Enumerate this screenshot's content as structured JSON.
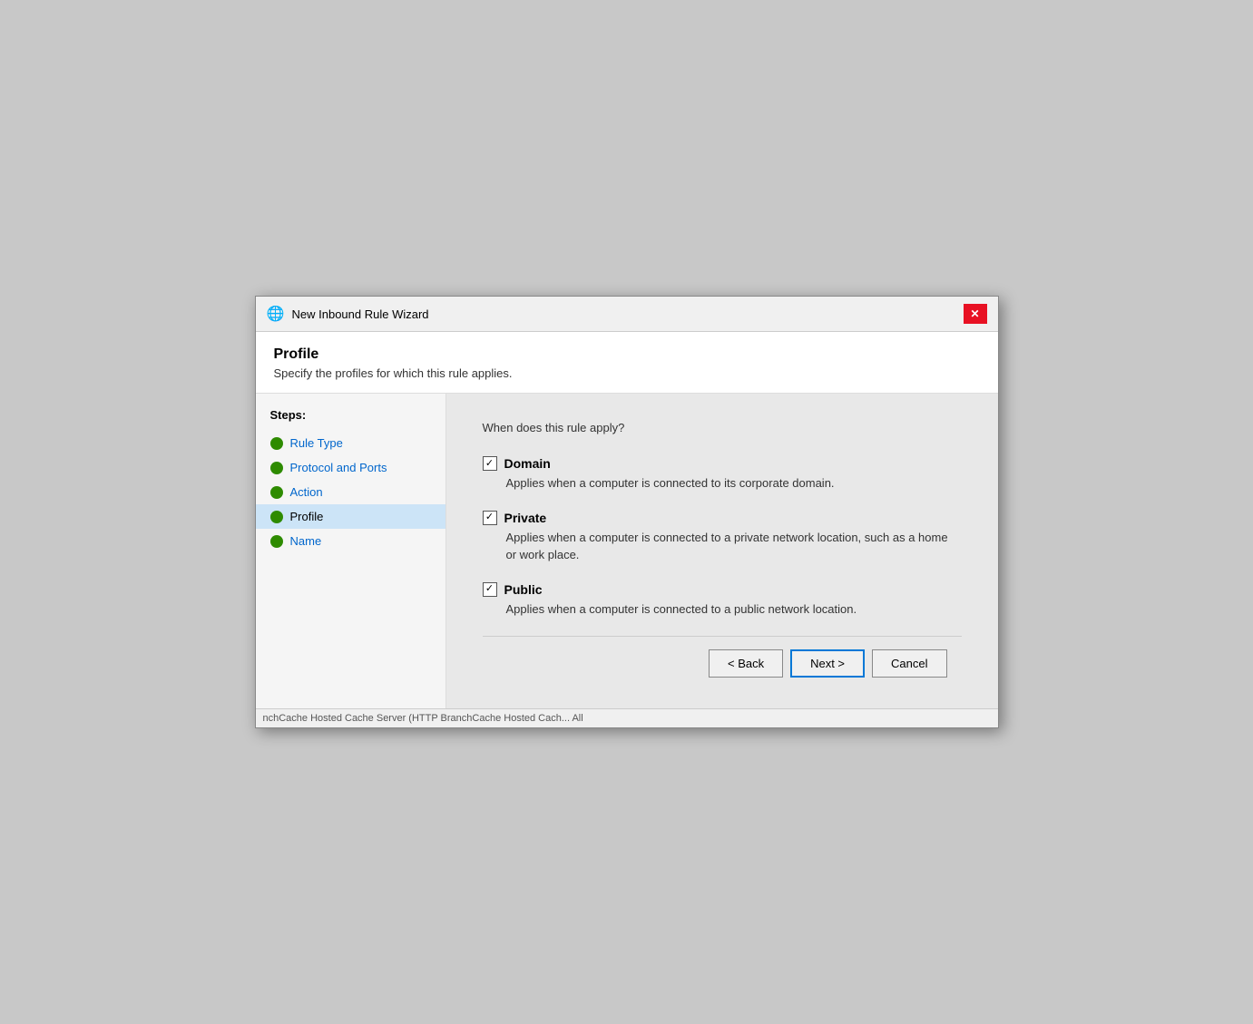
{
  "titleBar": {
    "icon": "🌐",
    "title": "New Inbound Rule Wizard",
    "closeLabel": "✕"
  },
  "header": {
    "heading": "Profile",
    "description": "Specify the profiles for which this rule applies."
  },
  "steps": {
    "label": "Steps:",
    "items": [
      {
        "id": "rule-type",
        "label": "Rule Type",
        "active": false,
        "completed": true
      },
      {
        "id": "protocol-and-ports",
        "label": "Protocol and Ports",
        "active": false,
        "completed": true
      },
      {
        "id": "action",
        "label": "Action",
        "active": false,
        "completed": true
      },
      {
        "id": "profile",
        "label": "Profile",
        "active": true,
        "completed": true
      },
      {
        "id": "name",
        "label": "Name",
        "active": false,
        "completed": true
      }
    ]
  },
  "main": {
    "questionText": "When does this rule apply?",
    "options": [
      {
        "id": "domain",
        "label": "Domain",
        "checked": true,
        "description": "Applies when a computer is connected to its corporate domain."
      },
      {
        "id": "private",
        "label": "Private",
        "checked": true,
        "description": "Applies when a computer is connected to a private network location, such as a home\nor work place."
      },
      {
        "id": "public",
        "label": "Public",
        "checked": true,
        "description": "Applies when a computer is connected to a public network location."
      }
    ]
  },
  "footer": {
    "backLabel": "< Back",
    "nextLabel": "Next >",
    "cancelLabel": "Cancel"
  },
  "taskbarHint": "nchCache Hosted Cache Server (HTTP    BranchCache    Hosted Cach...    All"
}
